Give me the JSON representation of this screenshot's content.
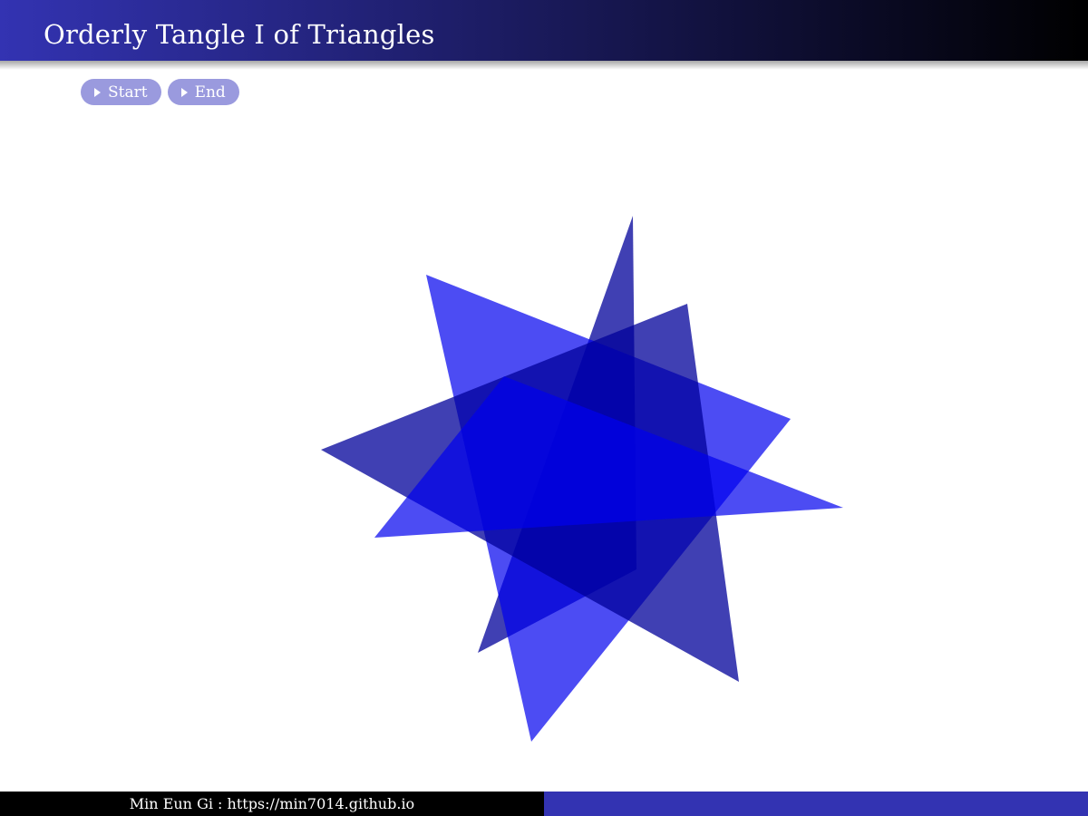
{
  "header": {
    "title": "Orderly Tangle I of Triangles"
  },
  "nav": {
    "start_label": "Start",
    "end_label": "End"
  },
  "footer": {
    "credit": "Min Eun Gi : https://min7014.github.io"
  },
  "colors": {
    "header_start": "#3333b2",
    "header_end": "#000000",
    "button_bg": "#9a9ade",
    "footer_left": "#000000",
    "footer_right": "#3333b2",
    "triangle_bright": "#0000ee",
    "triangle_dark": "#00009a"
  },
  "icons": {
    "nav_arrow": "play-triangle-icon"
  }
}
